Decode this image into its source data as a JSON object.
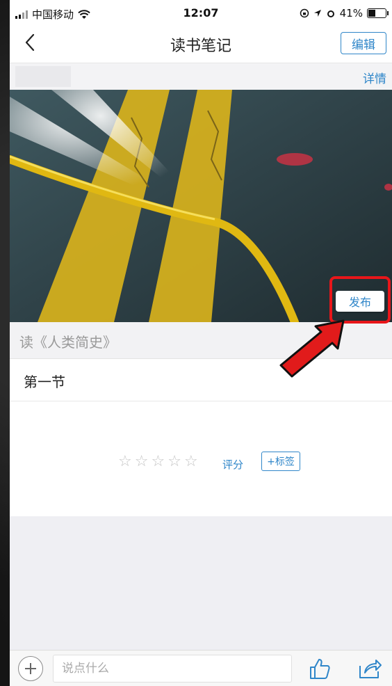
{
  "status_bar": {
    "carrier": "中国移动",
    "time": "12:07",
    "battery": "41%"
  },
  "nav": {
    "title": "读书笔记",
    "edit_label": "编辑",
    "back_icon": "chevron-left-icon"
  },
  "details": {
    "link_label": "详情"
  },
  "cover": {
    "publish_label": "发布"
  },
  "note": {
    "book_title": "读《人类简史》",
    "section_title": "第一节"
  },
  "rating": {
    "stars": [
      "☆",
      "☆",
      "☆",
      "☆",
      "☆"
    ],
    "rate_label": "评分",
    "tag_label": "+标签"
  },
  "bottom_bar": {
    "comment_placeholder": "说点什么",
    "icons": [
      "plus-circle-icon",
      "thumbs-up-icon",
      "share-icon"
    ]
  },
  "colors": {
    "accent": "#2f86c9",
    "highlight": "#e8161a"
  }
}
